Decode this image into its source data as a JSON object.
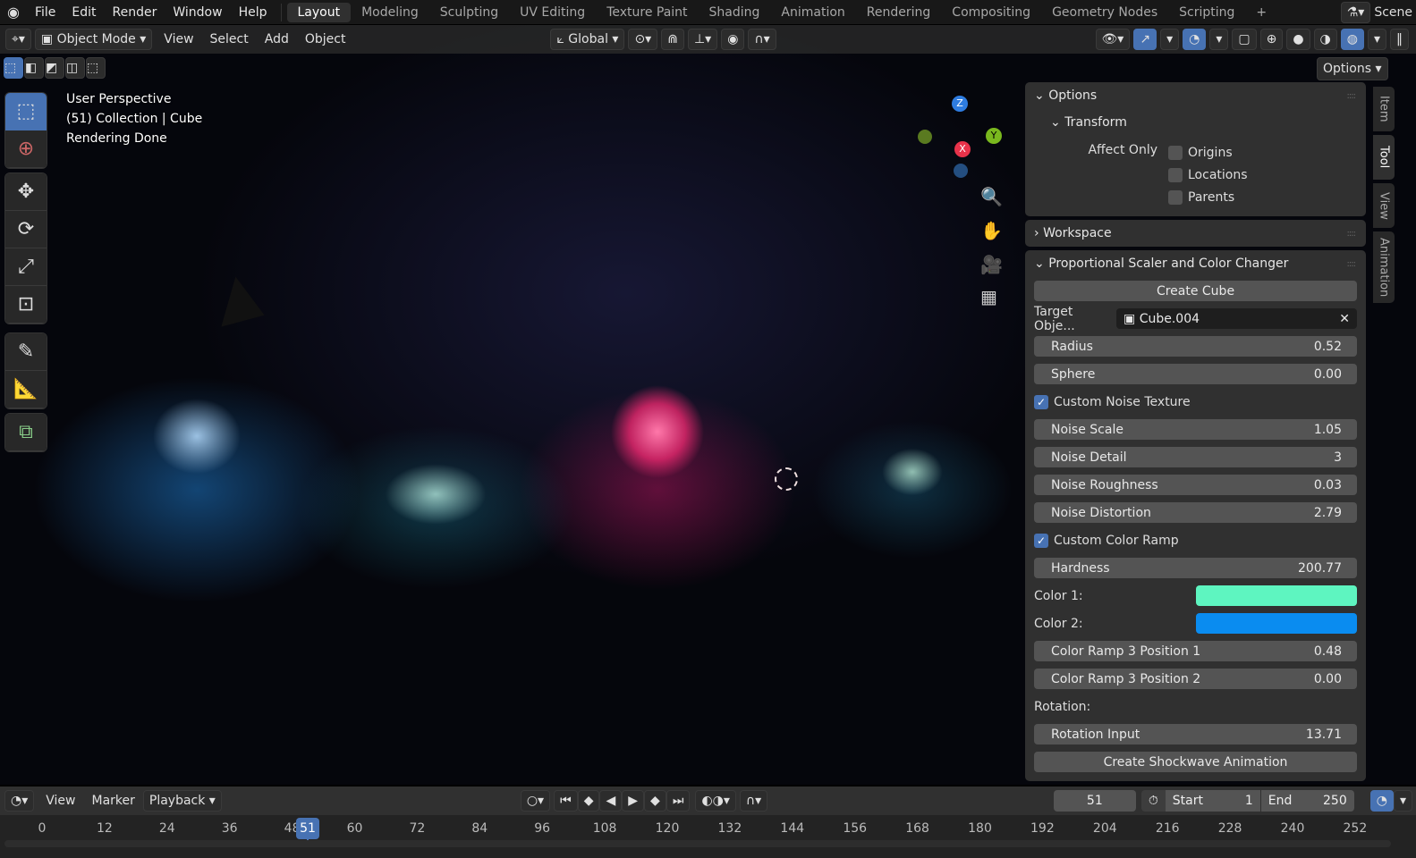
{
  "topbar": {
    "menus": [
      "File",
      "Edit",
      "Render",
      "Window",
      "Help"
    ],
    "workspaces": [
      "Layout",
      "Modeling",
      "Sculpting",
      "UV Editing",
      "Texture Paint",
      "Shading",
      "Animation",
      "Rendering",
      "Compositing",
      "Geometry Nodes",
      "Scripting"
    ],
    "active_workspace": "Layout",
    "add": "+",
    "scene": "Scene"
  },
  "header": {
    "mode": "Object Mode",
    "menus": [
      "View",
      "Select",
      "Add",
      "Object"
    ],
    "orientation": "Global",
    "options": "Options"
  },
  "overlay": {
    "view": "User Perspective",
    "collection": "(51) Collection | Cube",
    "status": "Rendering Done"
  },
  "gizmo": {
    "x": "X",
    "y": "Y",
    "z": "Z"
  },
  "sidebar": {
    "tabs": [
      "Item",
      "Tool",
      "View",
      "Animation"
    ],
    "active_tab": "Tool",
    "options": {
      "title": "Options",
      "transform": "Transform",
      "affect_only": "Affect Only",
      "checks": [
        "Origins",
        "Locations",
        "Parents"
      ]
    },
    "workspace": "Workspace",
    "addon": {
      "title": "Proportional Scaler and Color Changer",
      "create_cube": "Create Cube",
      "target_label": "Target Obje...",
      "target_value": "Cube.004",
      "radius": {
        "label": "Radius",
        "value": "0.52"
      },
      "sphere": {
        "label": "Sphere",
        "value": "0.00"
      },
      "custom_noise": "Custom Noise Texture",
      "noise_scale": {
        "label": "Noise Scale",
        "value": "1.05"
      },
      "noise_detail": {
        "label": "Noise Detail",
        "value": "3"
      },
      "noise_roughness": {
        "label": "Noise Roughness",
        "value": "0.03"
      },
      "noise_distortion": {
        "label": "Noise Distortion",
        "value": "2.79"
      },
      "custom_ramp": "Custom Color Ramp",
      "hardness": {
        "label": "Hardness",
        "value": "200.77"
      },
      "color1": {
        "label": "Color 1:",
        "value": "#5ef5c0"
      },
      "color2": {
        "label": "Color 2:",
        "value": "#0a8cf0"
      },
      "ramp_pos1": {
        "label": "Color Ramp 3 Position 1",
        "value": "0.48"
      },
      "ramp_pos2": {
        "label": "Color Ramp 3 Position 2",
        "value": "0.00"
      },
      "rotation": "Rotation:",
      "rotation_input": {
        "label": "Rotation Input",
        "value": "13.71"
      },
      "shockwave": "Create Shockwave Animation"
    }
  },
  "timeline": {
    "menus": [
      "View",
      "Marker"
    ],
    "playback": "Playback",
    "current_frame": "51",
    "start_label": "Start",
    "start": "1",
    "end_label": "End",
    "end": "250",
    "ticks": [
      "0",
      "12",
      "24",
      "36",
      "48",
      "60",
      "72",
      "84",
      "96",
      "108",
      "120",
      "132",
      "144",
      "156",
      "168",
      "180",
      "192",
      "204",
      "216",
      "228",
      "240",
      "252"
    ]
  }
}
